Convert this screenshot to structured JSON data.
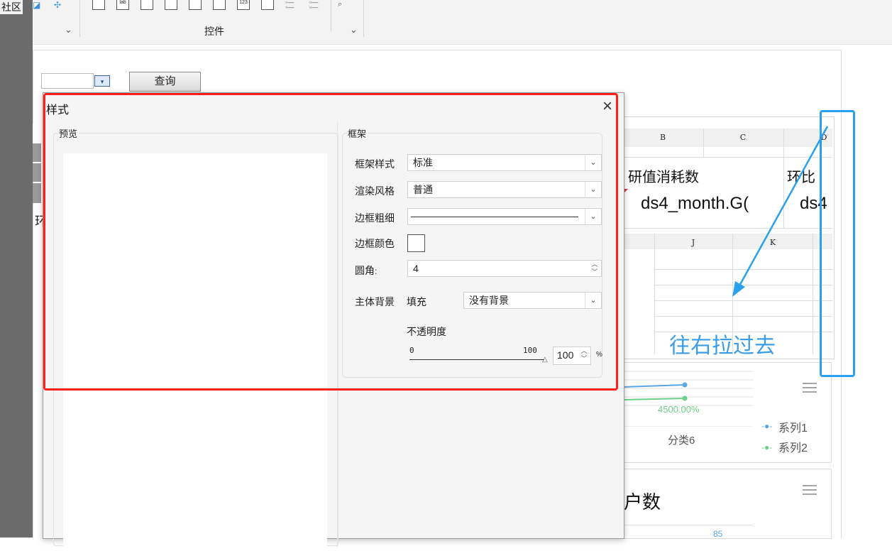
{
  "left_strip": {
    "top_text": "社区"
  },
  "toolbar": {
    "controls_label": "控件",
    "chevron": "⌄",
    "icons": [
      "paint-icon",
      "sparkle-icon",
      "text-box-icon",
      "label-icon",
      "button-icon",
      "dropdown-icon",
      "date-icon",
      "table-icon",
      "number-icon",
      "list-icon",
      "radio-icon",
      "checkbox-icon",
      "search-icon"
    ]
  },
  "param_bar": {
    "query_button": "查询"
  },
  "dialog": {
    "title": "样式",
    "close": "×",
    "preview_label": "预览",
    "frame_label": "框架",
    "frame_style": {
      "label": "框架样式",
      "value": "标准"
    },
    "render_style": {
      "label": "渲染风格",
      "value": "普通"
    },
    "border_width": {
      "label": "边框粗细"
    },
    "border_color": {
      "label": "边框颜色",
      "value": "#ffffff"
    },
    "corner_radius": {
      "label": "圆角",
      "colon": ":",
      "value": "4"
    },
    "body_background": {
      "label": "主体背景",
      "fill_label": "填充",
      "value": "没有背景"
    },
    "opacity": {
      "label": "不透明度",
      "min": "0",
      "max": "100",
      "value": "100",
      "unit": "%"
    }
  },
  "sheet": {
    "col_headers_top": [
      "B",
      "C",
      "D"
    ],
    "col_headers_bottom": [
      "J",
      "K"
    ],
    "cell_title": "研值消耗数",
    "cell_title2": "环比",
    "cell_formula": "ds4_month.G(",
    "cell_formula2": "ds4"
  },
  "left_sheet": {
    "cell_char": "环"
  },
  "chart1": {
    "data_label": "4500.00%",
    "category": "分类6",
    "legend": [
      "系列1",
      "系列2"
    ],
    "series_colors": [
      "#5aa7e6",
      "#6dd089"
    ]
  },
  "chart2": {
    "title": "户数",
    "data_label": "85"
  },
  "annotation": {
    "text": "往右拉过去",
    "highlight_color": "#ff1f1f",
    "arrow_color": "#2aa0ee"
  }
}
